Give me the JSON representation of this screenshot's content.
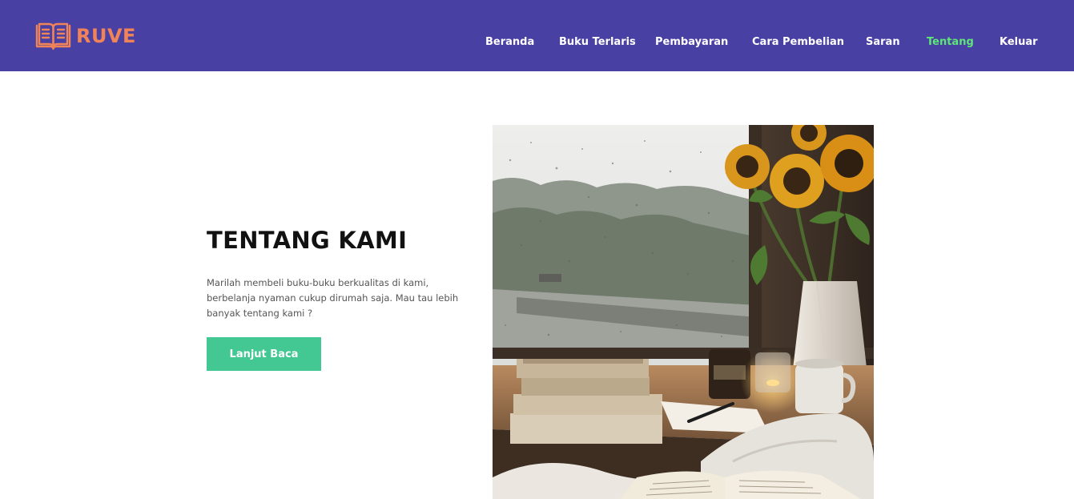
{
  "brand": {
    "name": "RUVE",
    "logo_icon": "open-book-icon",
    "color": "#f08357"
  },
  "nav": {
    "background": "#4940a3",
    "active_color": "#5ee679",
    "items": [
      {
        "label": "Beranda"
      },
      {
        "label": "Buku Terlaris"
      },
      {
        "label": "Pembayaran"
      },
      {
        "label": "Cara Pembelian"
      },
      {
        "label": "Saran"
      },
      {
        "label": "Tentang",
        "active": true
      },
      {
        "label": "Keluar"
      }
    ]
  },
  "hero": {
    "title": "TENTANG KAMI",
    "description": "Marilah membeli buku-buku berkualitas di kami, berbelanja nyaman cukup dirumah saja. Mau tau lebih banyak tentang kami ?",
    "button_label": "Lanjut Baca",
    "button_color": "#43c793",
    "image": "rainy-window-books-sunflowers-photo"
  }
}
